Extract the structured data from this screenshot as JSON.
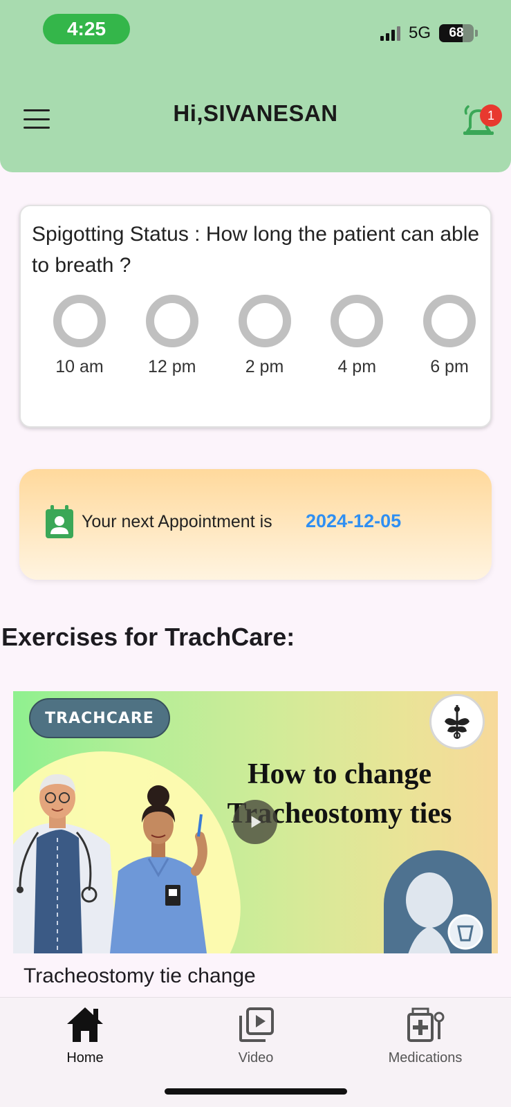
{
  "status_bar": {
    "time": "4:25",
    "network": "5G",
    "battery_level": "68",
    "battery_fraction": 0.68,
    "icons": [
      "cellular-signal-icon",
      "battery-icon"
    ]
  },
  "header": {
    "greeting": "Hi,SIVANESAN",
    "notification_count": "1",
    "background_color": "#a8dbaf",
    "icons": [
      "menu-icon",
      "alarm-bell-icon"
    ]
  },
  "spigotting": {
    "question": "Spigotting Status : How long the patient can able to breath ?",
    "slots": [
      {
        "label": "10 am",
        "selected": false
      },
      {
        "label": "12 pm",
        "selected": false
      },
      {
        "label": "2 pm",
        "selected": false
      },
      {
        "label": "4 pm",
        "selected": false
      },
      {
        "label": "6 pm",
        "selected": false
      }
    ]
  },
  "appointment": {
    "text": "Your next Appointment is",
    "date": "2024-12-05",
    "date_color": "#2f8ff2",
    "icon": "calendar-person-icon",
    "icon_color": "#3aa757"
  },
  "exercises": {
    "section_title": "Exercises for TrachCare:",
    "videos": [
      {
        "thumbnail_tag": "TRACHCARE",
        "thumbnail_title_line1": "How to change",
        "thumbnail_title_line2": "Tracheostomy ties",
        "caption": "Tracheostomy tie change",
        "icon": "play-icon"
      }
    ]
  },
  "bottom_nav": {
    "items": [
      {
        "label": "Home",
        "icon": "home-icon",
        "active": true
      },
      {
        "label": "Video",
        "icon": "video-library-icon",
        "active": false
      },
      {
        "label": "Medications",
        "icon": "medical-kit-icon",
        "active": false
      }
    ]
  }
}
